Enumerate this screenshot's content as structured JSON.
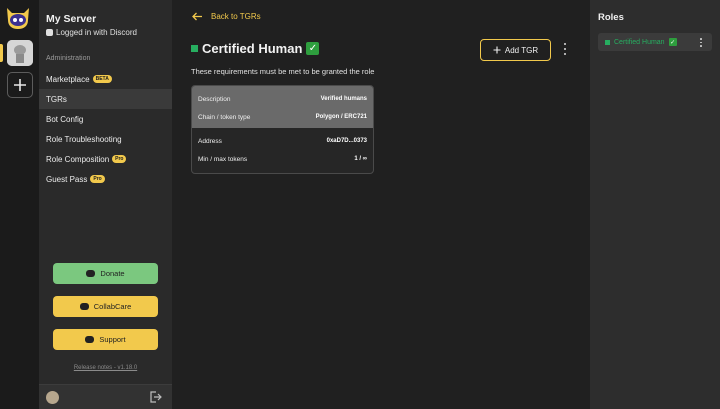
{
  "rail": {
    "logo_icon": "guild-bot-logo-icon",
    "add_server_icon": "plus-icon"
  },
  "sidebar": {
    "server_name": "My Server",
    "login_status": "Logged in with Discord",
    "section_label": "Administration",
    "nav_items": [
      {
        "label": "Marketplace",
        "badge": "BETA"
      },
      {
        "label": "TGRs",
        "badge": ""
      },
      {
        "label": "Bot Config",
        "badge": ""
      },
      {
        "label": "Role Troubleshooting",
        "badge": ""
      },
      {
        "label": "Role Composition",
        "badge": "Pro"
      },
      {
        "label": "Guest Pass",
        "badge": "Pro"
      }
    ],
    "buttons": {
      "donate": "Donate",
      "collabcare": "CollabCare",
      "support": "Support"
    },
    "release_notes": "Release notes - v1.18.0"
  },
  "main": {
    "back_label": "Back to TGRs",
    "title": "Certified Human",
    "add_tgr_label": "Add TGR",
    "requirements_text": "These requirements must be met to be granted the role",
    "tgr_card": {
      "description_label": "Description",
      "description_value": "Verified humans",
      "chain_label": "Chain / token type",
      "chain_value": "Polygon / ERC721",
      "address_label": "Address",
      "address_value": "0xaD7D...0373",
      "minmax_label": "Min / max tokens",
      "minmax_value": "1 / ∞"
    }
  },
  "roles": {
    "title": "Roles",
    "items": [
      {
        "label": "Certified Human"
      }
    ]
  },
  "colors": {
    "accent": "#f2c94c",
    "donate": "#7bc87f",
    "role_green": "#27ae60"
  }
}
